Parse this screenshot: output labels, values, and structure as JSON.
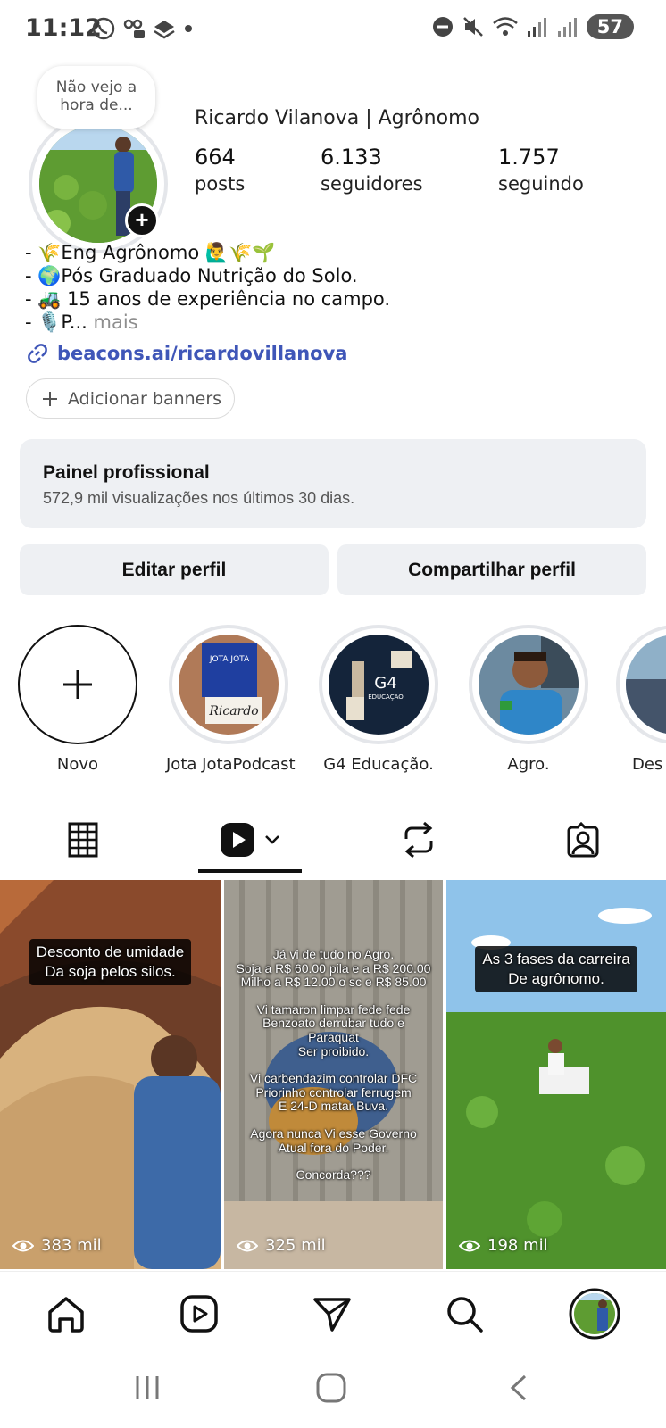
{
  "status_bar": {
    "time": "11:12",
    "battery": "57",
    "left_icons": [
      "whatsapp-icon",
      "voicemail-icon",
      "layers-icon",
      "dot-icon"
    ],
    "right_icons": [
      "dnd-icon",
      "mute-icon",
      "wifi-icon",
      "signal-icon",
      "signal-icon"
    ]
  },
  "profile": {
    "note": "Não vejo a hora de...",
    "name": "Ricardo Vilanova | Agrônomo",
    "stats": [
      {
        "value": "664",
        "label": "posts"
      },
      {
        "value": "6.133",
        "label": "seguidores"
      },
      {
        "value": "1.757",
        "label": "seguindo"
      }
    ],
    "bio": [
      "- 🌾Eng Agrônomo 🙋‍♂️🌾🌱",
      "- 🌍Pós Graduado Nutrição do Solo.",
      "- 🚜 15 anos de experiência no campo.",
      "- 🎙️P..."
    ],
    "bio_more": " mais",
    "link": "beacons.ai/ricardovillanova",
    "add_banners": "Adicionar banners"
  },
  "panel": {
    "title": "Painel profissional",
    "subtitle": "572,9 mil visualizações nos últimos 30 dias."
  },
  "actions": {
    "edit": "Editar perfil",
    "share": "Compartilhar perfil"
  },
  "highlights": [
    {
      "label": "Novo"
    },
    {
      "label": "Jota JotaPodcast"
    },
    {
      "label": "G4 Educação."
    },
    {
      "label": "Agro."
    },
    {
      "label": "Des"
    }
  ],
  "posts": [
    {
      "caption": [
        "Desconto de umidade",
        "Da soja pelos silos."
      ],
      "views": "383 mil"
    },
    {
      "caption": [
        "Já vi de tudo no Agro.",
        "Soja a R$ 60.00 pila e a R$ 200.00",
        "Milho a R$ 12.00 o sc e R$ 85.00",
        "",
        "Vi tamaron limpar fede fede",
        "Benzoato derrubar tudo e",
        "Paraquat",
        "Ser proibido.",
        "",
        "Vi carbendazim controlar DFC",
        "Priorinho controlar ferrugem",
        "E 24-D matar Buva.",
        "",
        "Agora nunca Vi esse Governo",
        "Atual fora do Poder.",
        "",
        "Concorda???"
      ],
      "views": "325 mil"
    },
    {
      "caption": [
        "As 3 fases da carreira",
        "De agrônomo."
      ],
      "views": "198 mil"
    }
  ],
  "colors": {
    "link": "#3f56b8",
    "panel_bg": "#eef0f3",
    "ring": "#e4e6ea"
  }
}
